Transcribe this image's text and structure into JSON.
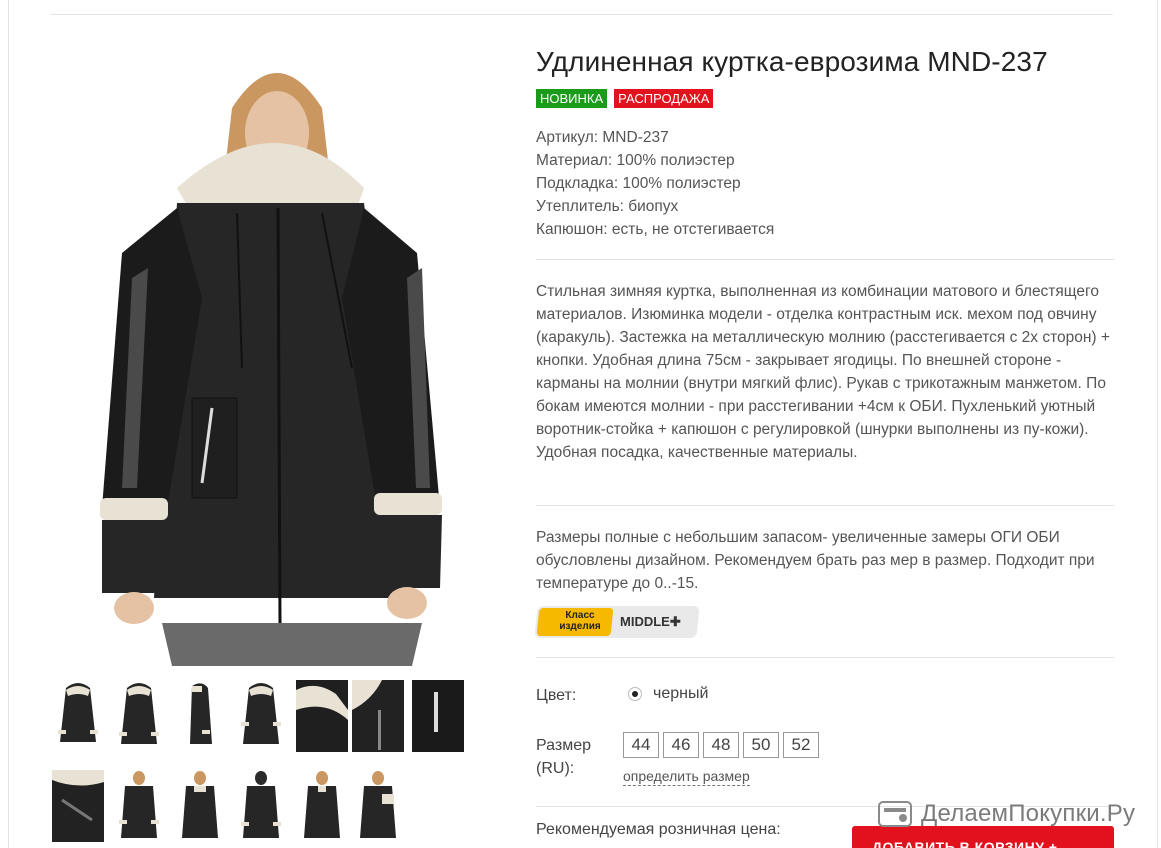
{
  "product": {
    "title": "Удлиненная куртка-еврозима MND-237",
    "badges": {
      "new": "НОВИНКА",
      "sale": "РАСПРОДАЖА"
    },
    "specs": [
      "Артикул: MND-237",
      "Материал: 100% полиэстер",
      "Подкладка: 100% полиэстер",
      "Утеплитель: биопух",
      "Капюшон: есть, не отстегивается"
    ],
    "description": "Стильная зимняя куртка, выполненная из комбинации матового и блестящего материалов. Изюминка модели - отделка контрастным иск. мехом под овчину (каракуль). Застежка на металлическую молнию (расстегивается с 2х сторон) + кнопки. Удобная длина 75см - закрывает ягодицы.  По внешней стороне - карманы на молнии (внутри мягкий флис). Рукав с трикотажным манжетом. По бокам имеются молнии - при расстегивании +4см к ОБИ. Пухленький уютный воротник-стойка + капюшон с регулировкой (шнурки выполнены из пу-кожи). Удобная посадка, качественные материалы.",
    "size_note": "Размеры полные с небольшим запасом- увеличенные замеры ОГИ ОБИ обусловлены дизайном. Рекомендуем брать раз мер в размер. Подходит при температуре до 0..-15.",
    "class_badge": {
      "tag_line1": "Класс",
      "tag_line2": "изделия",
      "level": "MIDDLE✚"
    },
    "color": {
      "label": "Цвет:",
      "value": "черный"
    },
    "size": {
      "label_line1": "Размер",
      "label_line2": "(RU):",
      "options": [
        "44",
        "46",
        "48",
        "50",
        "52"
      ],
      "link": "определить размер"
    },
    "price_label": "Рекомендуемая розничная цена:",
    "add_to_cart": "ДОБАВИТЬ В КОРЗИНУ  +"
  },
  "watermark": "ДелаемПокупки.Ру",
  "colors": {
    "accent_red": "#e2131f",
    "new_green": "#1a9c1a",
    "badge_yellow": "#f7b800"
  }
}
